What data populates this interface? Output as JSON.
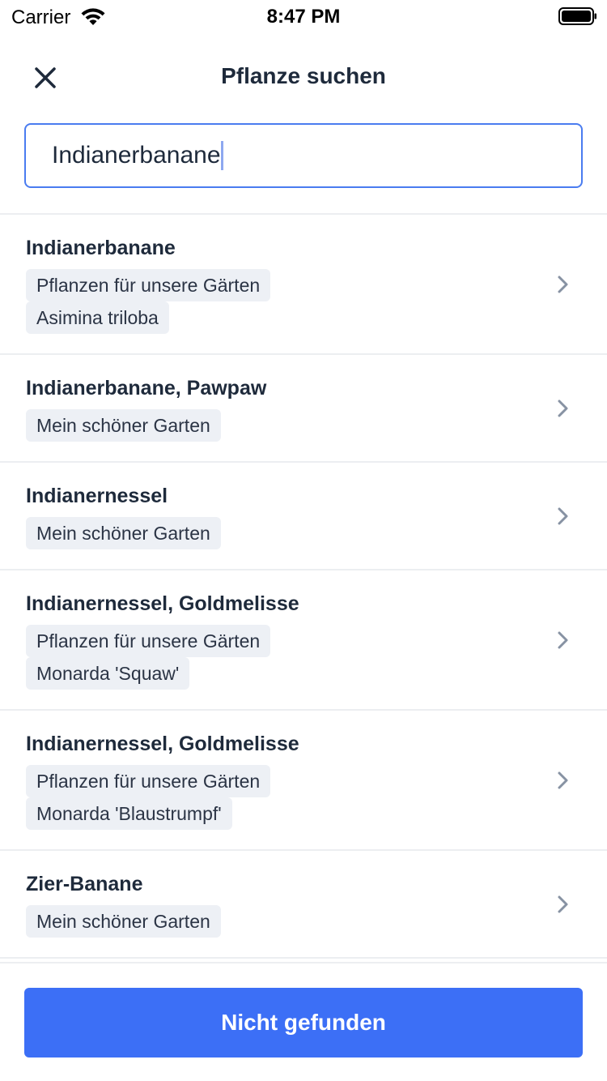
{
  "status_bar": {
    "carrier": "Carrier",
    "time": "8:47 PM"
  },
  "header": {
    "title": "Pflanze suchen"
  },
  "search": {
    "value": "Indianerbanane"
  },
  "results": [
    {
      "title": "Indianerbanane",
      "tags": [
        "Pflanzen für unsere Gärten",
        "Asimina triloba"
      ]
    },
    {
      "title": "Indianerbanane, Pawpaw",
      "tags": [
        "Mein schöner Garten"
      ]
    },
    {
      "title": "Indianernessel",
      "tags": [
        "Mein schöner Garten"
      ]
    },
    {
      "title": "Indianernessel, Goldmelisse",
      "tags": [
        "Pflanzen für unsere Gärten",
        "Monarda 'Squaw'"
      ]
    },
    {
      "title": "Indianernessel, Goldmelisse",
      "tags": [
        "Pflanzen für unsere Gärten",
        "Monarda 'Blaustrumpf'"
      ]
    },
    {
      "title": "Zier-Banane",
      "tags": [
        "Mein schöner Garten"
      ]
    }
  ],
  "footer": {
    "button_label": "Nicht gefunden"
  },
  "colors": {
    "accent": "#3c6ff6",
    "tag_bg": "#edf0f5",
    "divider": "#eceef1"
  }
}
